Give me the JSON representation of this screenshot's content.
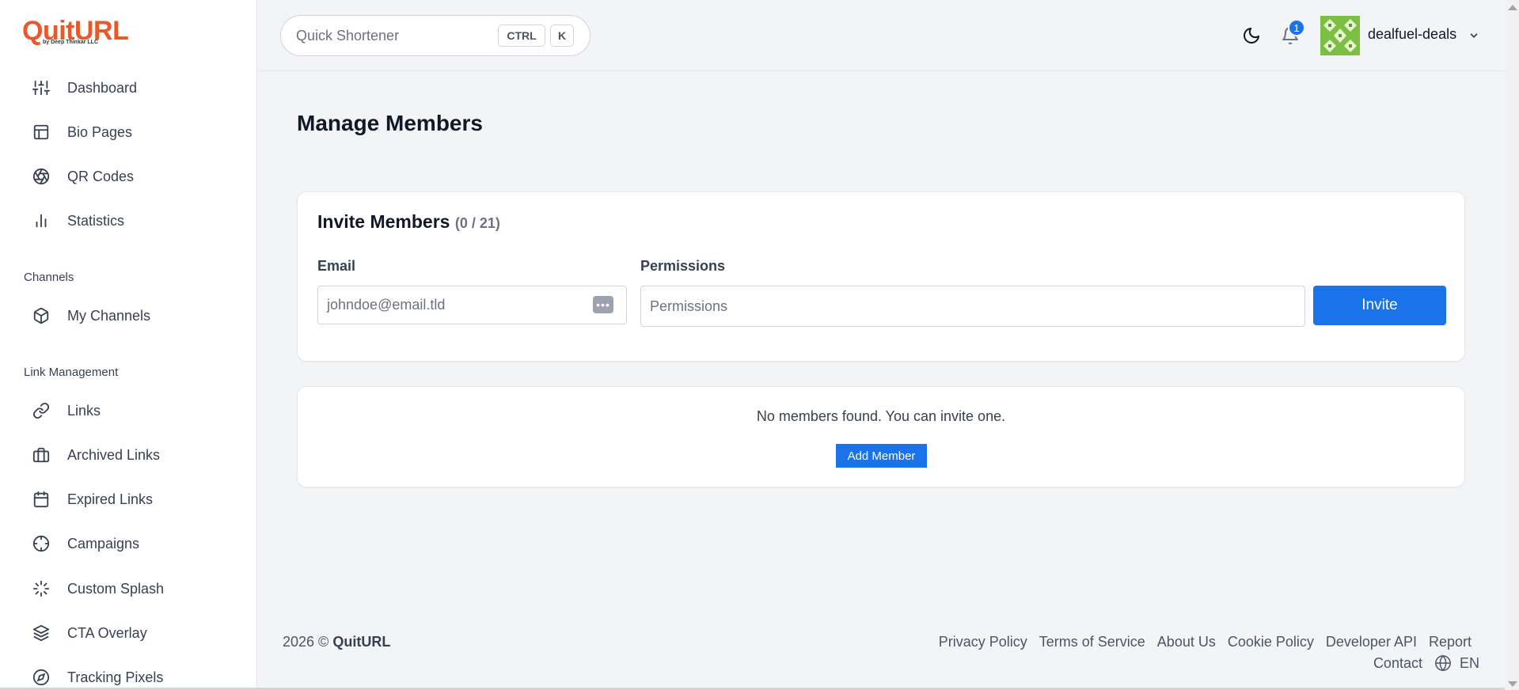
{
  "brand": {
    "logo_main": "QuitURL",
    "logo_sub": "by Deep Thinkar LLC",
    "color": "#e8592a"
  },
  "sidebar": {
    "items": [
      {
        "label": "Dashboard",
        "icon": "sliders-icon"
      },
      {
        "label": "Bio Pages",
        "icon": "layout-icon"
      },
      {
        "label": "QR Codes",
        "icon": "aperture-icon"
      },
      {
        "label": "Statistics",
        "icon": "bar-chart-icon"
      }
    ],
    "channels_title": "Channels",
    "channels": [
      {
        "label": "My Channels",
        "icon": "box-icon"
      }
    ],
    "link_mgmt_title": "Link Management",
    "link_items": [
      {
        "label": "Links",
        "icon": "link-icon"
      },
      {
        "label": "Archived Links",
        "icon": "briefcase-icon"
      },
      {
        "label": "Expired Links",
        "icon": "calendar-icon"
      },
      {
        "label": "Campaigns",
        "icon": "crosshair-icon"
      },
      {
        "label": "Custom Splash",
        "icon": "loader-icon"
      },
      {
        "label": "CTA Overlay",
        "icon": "layers-icon"
      },
      {
        "label": "Tracking Pixels",
        "icon": "compass-icon"
      }
    ]
  },
  "header": {
    "quick_placeholder": "Quick Shortener",
    "kbd_ctrl": "CTRL",
    "kbd_k": "K",
    "notification_count": "1",
    "username": "dealfuel-deals"
  },
  "main": {
    "page_title": "Manage Members",
    "invite": {
      "title": "Invite Members",
      "count": "(0 / 21)",
      "email_label": "Email",
      "email_placeholder": "johndoe@email.tld",
      "permissions_label": "Permissions",
      "permissions_placeholder": "Permissions",
      "invite_button": "Invite"
    },
    "empty": {
      "message": "No members found. You can invite one.",
      "add_button": "Add Member"
    }
  },
  "footer": {
    "year": "2026 ©",
    "brand": "QuitURL",
    "links": [
      "Privacy Policy",
      "Terms of Service",
      "About Us",
      "Cookie Policy",
      "Developer API",
      "Report"
    ],
    "contact": "Contact",
    "language": "EN"
  },
  "colors": {
    "primary": "#1a73e8",
    "brand": "#e8592a",
    "avatar": "#7bc043"
  }
}
